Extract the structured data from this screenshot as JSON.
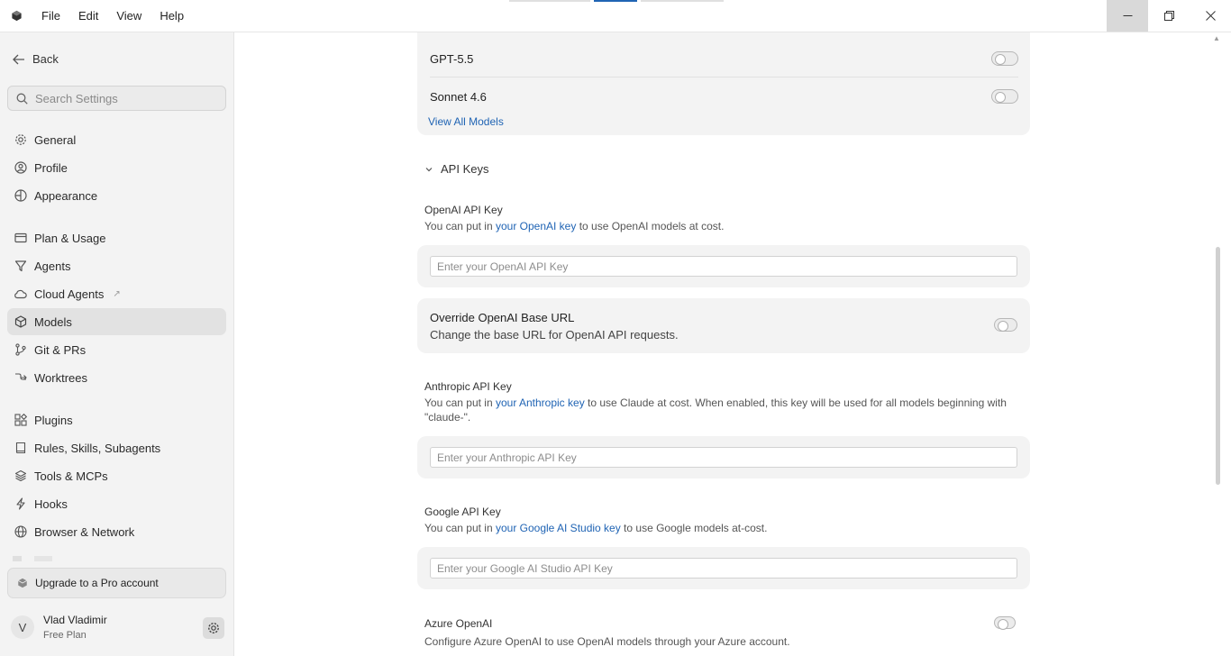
{
  "titlebar": {
    "menu": [
      "File",
      "Edit",
      "View",
      "Help"
    ]
  },
  "sidebar": {
    "back_label": "Back",
    "search_placeholder": "Search Settings",
    "groups": [
      [
        {
          "label": "General",
          "icon": "gear-icon"
        },
        {
          "label": "Profile",
          "icon": "user-circle-icon"
        },
        {
          "label": "Appearance",
          "icon": "palette-icon"
        }
      ],
      [
        {
          "label": "Plan & Usage",
          "icon": "card-icon"
        },
        {
          "label": "Agents",
          "icon": "funnel-icon"
        },
        {
          "label": "Cloud Agents",
          "icon": "cloud-icon",
          "external": "↗"
        },
        {
          "label": "Models",
          "icon": "cube-icon",
          "active": true
        },
        {
          "label": "Git & PRs",
          "icon": "git-branch-icon"
        },
        {
          "label": "Worktrees",
          "icon": "worktree-icon"
        }
      ],
      [
        {
          "label": "Plugins",
          "icon": "puzzle-icon"
        },
        {
          "label": "Rules, Skills, Subagents",
          "icon": "book-icon"
        },
        {
          "label": "Tools & MCPs",
          "icon": "layers-icon"
        },
        {
          "label": "Hooks",
          "icon": "lightning-icon"
        },
        {
          "label": "Browser & Network",
          "icon": "globe-icon"
        }
      ]
    ],
    "upgrade_label": "Upgrade to a Pro account",
    "user": {
      "initial": "V",
      "name": "Vlad Vladimir",
      "plan": "Free Plan"
    }
  },
  "models": {
    "items": [
      {
        "name": "GPT-5.5",
        "enabled": false
      },
      {
        "name": "Sonnet 4.6",
        "enabled": false
      }
    ],
    "view_all_label": "View All Models"
  },
  "api_keys": {
    "section_label": "API Keys",
    "openai": {
      "title": "OpenAI API Key",
      "desc_prefix": "You can put in ",
      "desc_link": "your OpenAI key",
      "desc_suffix": " to use OpenAI models at cost.",
      "placeholder": "Enter your OpenAI API Key"
    },
    "override": {
      "title": "Override OpenAI Base URL",
      "desc": "Change the base URL for OpenAI API requests.",
      "enabled": false
    },
    "anthropic": {
      "title": "Anthropic API Key",
      "desc_prefix": "You can put in ",
      "desc_link": "your Anthropic key",
      "desc_suffix": " to use Claude at cost. When enabled, this key will be used for all models beginning with \"claude-\".",
      "placeholder": "Enter your Anthropic API Key"
    },
    "google": {
      "title": "Google API Key",
      "desc_prefix": "You can put in ",
      "desc_link": "your Google AI Studio key",
      "desc_suffix": " to use Google models at-cost.",
      "placeholder": "Enter your Google AI Studio API Key"
    },
    "azure": {
      "title": "Azure OpenAI",
      "desc": "Configure Azure OpenAI to use OpenAI models through your Azure account.",
      "enabled": false
    }
  },
  "colors": {
    "link": "#2064b4",
    "active_nav": "#e2e2e2",
    "card": "#f3f3f3"
  }
}
